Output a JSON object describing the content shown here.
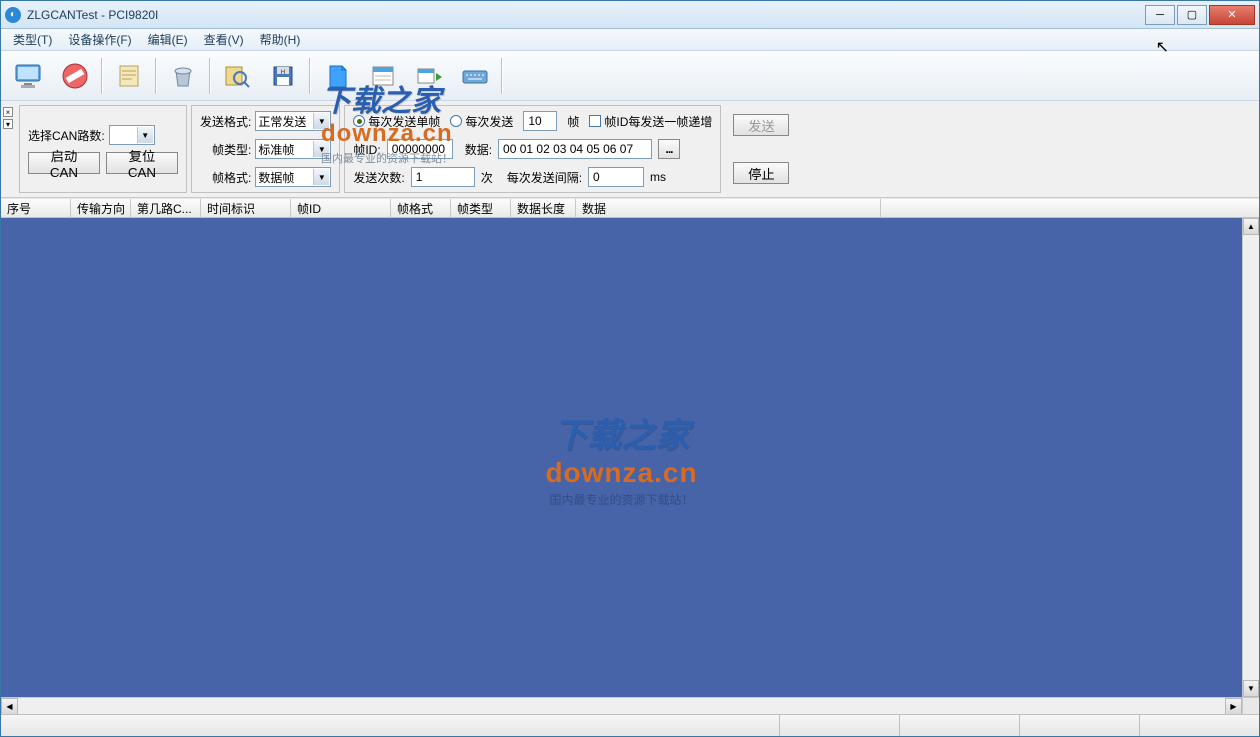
{
  "title": "ZLGCANTest - PCI9820I",
  "menu": [
    "类型(T)",
    "设备操作(F)",
    "编辑(E)",
    "查看(V)",
    "帮助(H)"
  ],
  "can_select_label": "选择CAN路数:",
  "can_select_value": "",
  "start_can": "启动CAN",
  "reset_can": "复位CAN",
  "send_format_label": "发送格式:",
  "send_format_value": "正常发送",
  "frame_type_label": "帧类型:",
  "frame_type_value": "标准帧",
  "frame_format_label": "帧格式:",
  "frame_format_value": "数据帧",
  "radio_single": "每次发送单帧",
  "radio_multi_prefix": "每次发送",
  "radio_multi_count": "10",
  "radio_multi_suffix": "帧",
  "check_increment": "帧ID每发送一帧递增",
  "frame_id_label": "帧ID:",
  "frame_id_value": "00000000",
  "data_label": "数据:",
  "data_value": "00 01 02 03 04 05 06 07",
  "send_btn": "发送",
  "send_count_label": "发送次数:",
  "send_count_value": "1",
  "send_count_unit": "次",
  "interval_label": "每次发送间隔:",
  "interval_value": "0",
  "interval_unit": "ms",
  "stop_btn": "停止",
  "columns": [
    "序号",
    "传输方向",
    "第几路C...",
    "时间标识",
    "帧ID",
    "帧格式",
    "帧类型",
    "数据长度",
    "数据"
  ],
  "watermark_cn": "下载之家",
  "watermark_en": "downza.cn",
  "watermark_sub": "国内最专业的资源下载站！"
}
